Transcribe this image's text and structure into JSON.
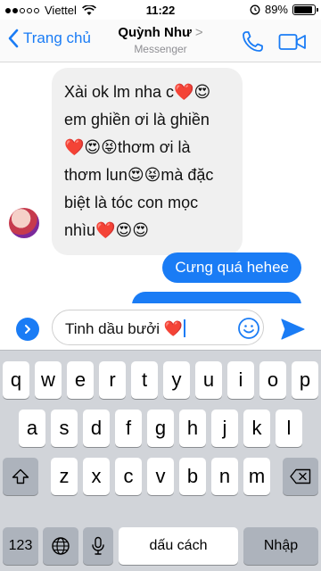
{
  "status_bar": {
    "carrier": "Viettel",
    "time": "11:22",
    "battery_percent": "89%",
    "battery_level": 0.89,
    "signal_bars_filled": 2,
    "signal_bars_total": 5
  },
  "nav": {
    "back_label": "Trang chủ",
    "contact_name": "Quỳnh Như",
    "title_chevron": ">",
    "subtitle": "Messenger",
    "accent_color": "#1a7cf5"
  },
  "messages": {
    "incoming": {
      "text": "Xài ok lm nha c❤️😍 em ghiền ơi là ghiền ❤️😍😝thơm ơi là thơm lun😍😝mà đặc biệt là tóc con mọc nhìu❤️😍😍"
    },
    "outgoing": [
      {
        "text": "Cưng quá hehee"
      },
      {
        "text": ""
      }
    ]
  },
  "composer": {
    "input_value": "Tinh dầu bưởi ❤️"
  },
  "keyboard": {
    "row1": [
      "q",
      "w",
      "e",
      "r",
      "t",
      "y",
      "u",
      "i",
      "o",
      "p"
    ],
    "row2": [
      "a",
      "s",
      "d",
      "f",
      "g",
      "h",
      "j",
      "k",
      "l"
    ],
    "row3": [
      "z",
      "x",
      "c",
      "v",
      "b",
      "n",
      "m"
    ],
    "numbers_label": "123",
    "space_label": "dấu cách",
    "return_label": "Nhập"
  }
}
